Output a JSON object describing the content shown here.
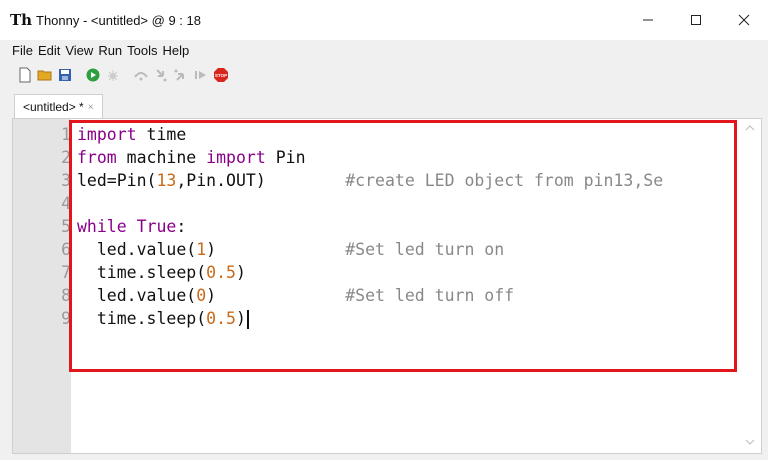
{
  "window": {
    "title": "Thonny  -  <untitled>  @  9 : 18",
    "app_icon_text": "Th",
    "controls": [
      "minimize",
      "maximize",
      "close"
    ]
  },
  "menu": [
    "File",
    "Edit",
    "View",
    "Run",
    "Tools",
    "Help"
  ],
  "toolbar": {
    "buttons": [
      "new-file",
      "open-file",
      "save-file",
      "run",
      "debug",
      "step-over",
      "step-into",
      "step-out",
      "resume",
      "stop"
    ],
    "stop_label": "STOP",
    "colors": {
      "run": "#2e9e3e",
      "stop": "#d7261e",
      "open": "#e5a823",
      "save": "#3461b0"
    }
  },
  "tab": {
    "label": "<untitled> *",
    "close": "×"
  },
  "editor": {
    "line_numbers": [
      "1",
      "2",
      "3",
      "4",
      "5",
      "6",
      "7",
      "8",
      "9"
    ],
    "lines": [
      [
        {
          "t": "import",
          "c": "kw"
        },
        {
          "t": " time",
          "c": ""
        }
      ],
      [
        {
          "t": "from",
          "c": "kw"
        },
        {
          "t": " machine ",
          "c": ""
        },
        {
          "t": "import",
          "c": "kw"
        },
        {
          "t": " Pin",
          "c": ""
        }
      ],
      [
        {
          "t": "led=Pin(",
          "c": ""
        },
        {
          "t": "13",
          "c": "num"
        },
        {
          "t": ",Pin.OUT)        ",
          "c": ""
        },
        {
          "t": "#create LED object from pin13,Se",
          "c": "cmt"
        }
      ],
      [],
      [
        {
          "t": "while",
          "c": "kw"
        },
        {
          "t": " ",
          "c": ""
        },
        {
          "t": "True",
          "c": "kw"
        },
        {
          "t": ":",
          "c": ""
        }
      ],
      [
        {
          "t": "  led.value(",
          "c": ""
        },
        {
          "t": "1",
          "c": "num"
        },
        {
          "t": ")             ",
          "c": ""
        },
        {
          "t": "#Set led turn on",
          "c": "cmt"
        }
      ],
      [
        {
          "t": "  time.sleep(",
          "c": ""
        },
        {
          "t": "0.5",
          "c": "num"
        },
        {
          "t": ")",
          "c": ""
        }
      ],
      [
        {
          "t": "  led.value(",
          "c": ""
        },
        {
          "t": "0",
          "c": "num"
        },
        {
          "t": ")             ",
          "c": ""
        },
        {
          "t": "#Set led turn off",
          "c": "cmt"
        }
      ],
      [
        {
          "t": "  time.sleep(",
          "c": ""
        },
        {
          "t": "0.5",
          "c": "num"
        },
        {
          "t": ")",
          "c": ""
        }
      ]
    ],
    "cursor_line": 9,
    "highlight_color": "#e0161c"
  }
}
